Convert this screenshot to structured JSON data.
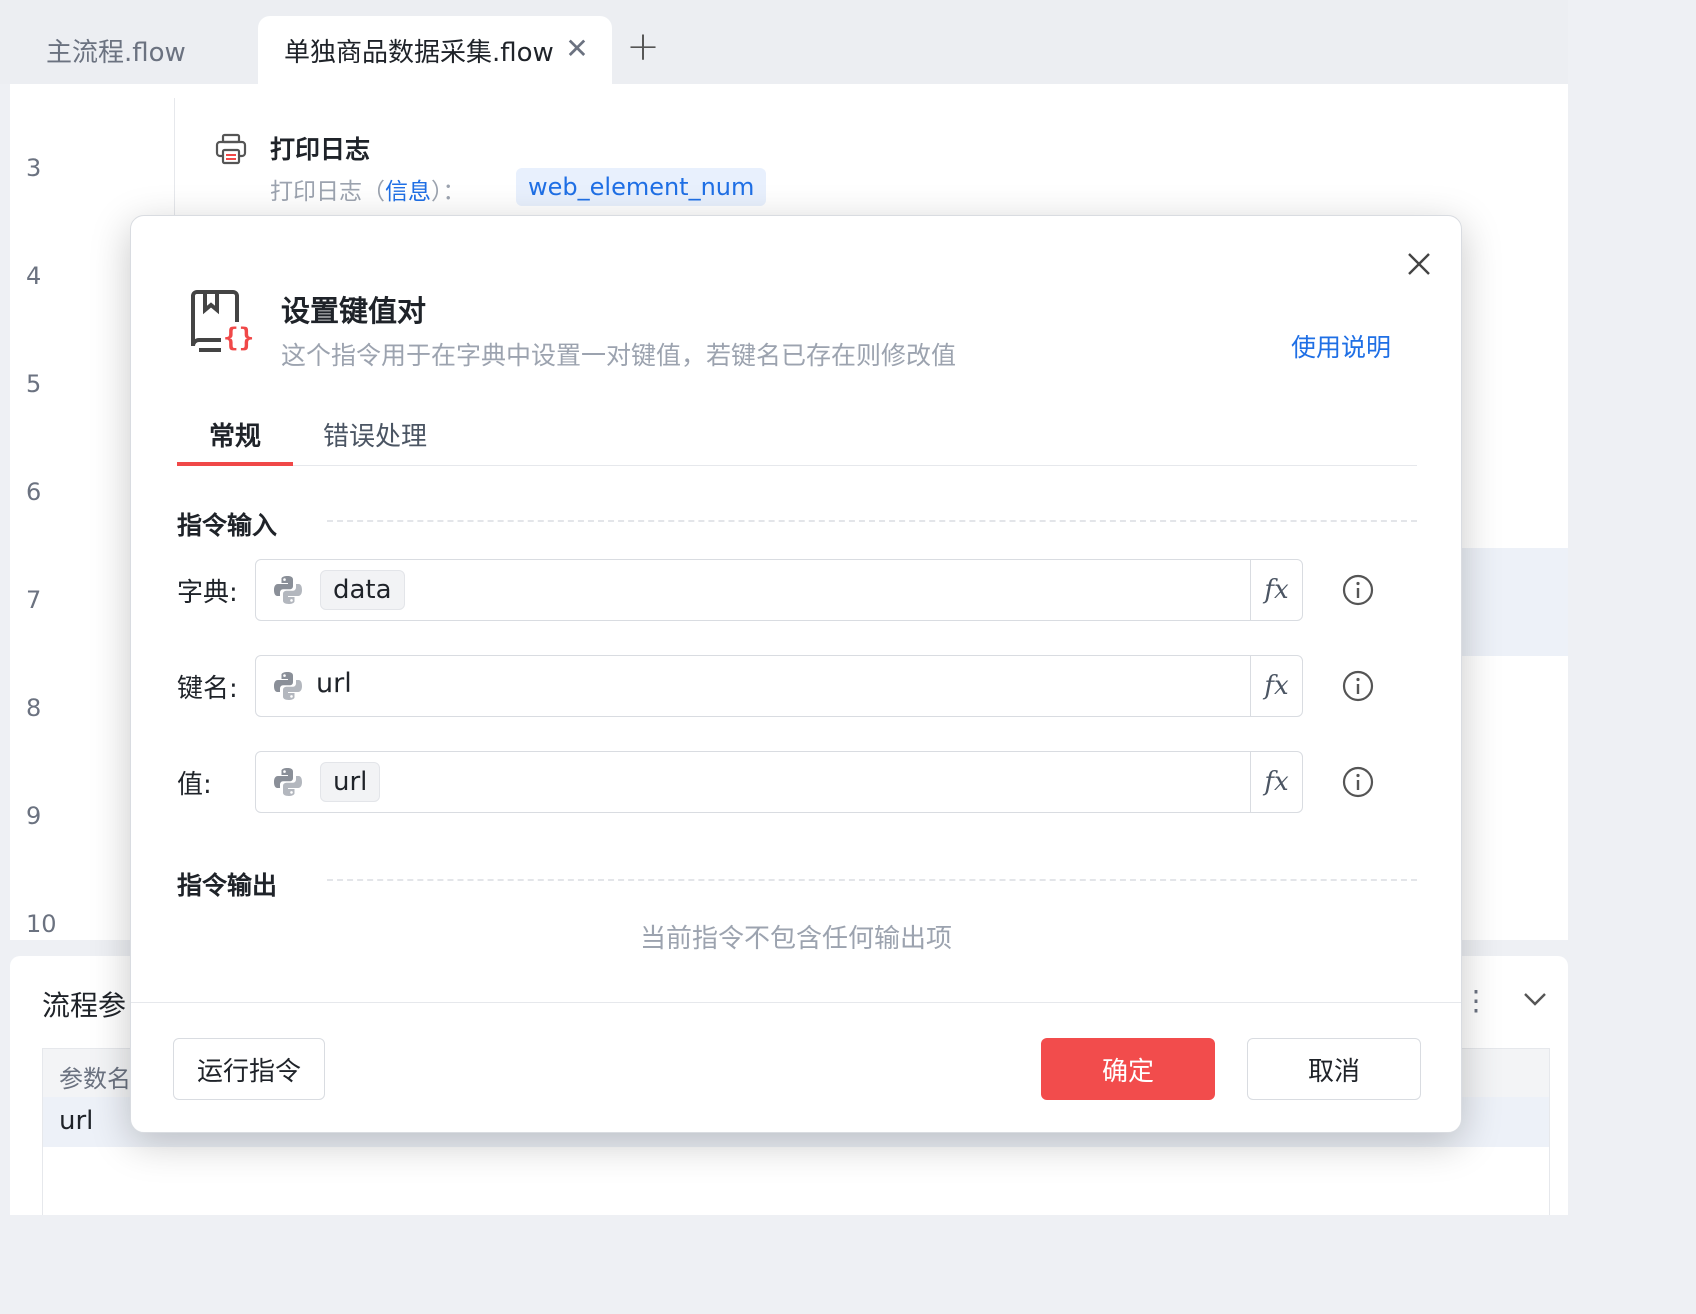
{
  "tabs": {
    "main": "主流程.flow",
    "active": "单独商品数据采集.flow",
    "close_glyph": "✕",
    "add_glyph": "+"
  },
  "editor": {
    "line_numbers": [
      "3",
      "4",
      "5",
      "6",
      "7",
      "8",
      "9",
      "10"
    ],
    "step3": {
      "icon": "printer-icon",
      "title": "打印日志",
      "desc_prefix": "打印日志（",
      "desc_keyword": "信息",
      "desc_suffix": "）：",
      "value": "web_element_num"
    }
  },
  "bottom_panel": {
    "title": "流程参",
    "more_glyph": "⋮",
    "table": {
      "header": "参数名",
      "rows": [
        {
          "name": "url"
        }
      ]
    }
  },
  "modal": {
    "title": "设置键值对",
    "description": "这个指令用于在字典中设置一对键值，若键名已存在则修改值",
    "help_link": "使用说明",
    "icon": "dictionary-book-icon",
    "tabs": [
      "常规",
      "错误处理"
    ],
    "input_section": "指令输入",
    "output_section": "指令输出",
    "fields": [
      {
        "label": "字典:",
        "value": "data",
        "type": "chip"
      },
      {
        "label": "键名:",
        "value": "url",
        "type": "text"
      },
      {
        "label": "值:",
        "value": "url",
        "type": "chip"
      }
    ],
    "fx_label": "fx",
    "no_output": "当前指令不包含任何输出项",
    "buttons": {
      "run": "运行指令",
      "ok": "确定",
      "cancel": "取消"
    }
  },
  "colors": {
    "accent_red": "#f24c4c",
    "link_blue": "#1f6fe5",
    "muted_text": "#9ca3af"
  }
}
